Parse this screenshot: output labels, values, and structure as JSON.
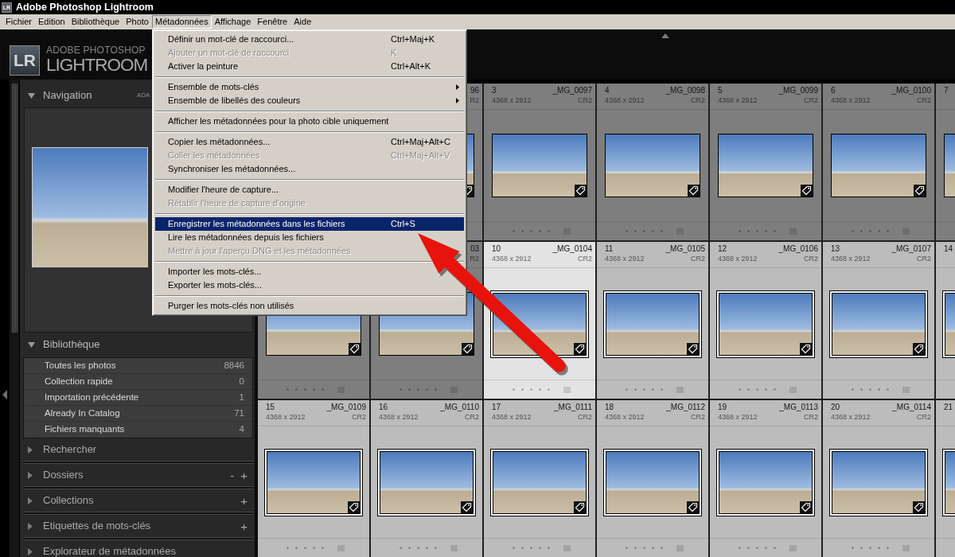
{
  "window": {
    "icon_text": "LR",
    "title": "Adobe Photoshop Lightroom"
  },
  "menu_bar": {
    "items": [
      {
        "label": "Fichier",
        "selected": false
      },
      {
        "label": "Edition",
        "selected": false
      },
      {
        "label": "Bibliothèque",
        "selected": false
      },
      {
        "label": "Photo",
        "selected": false
      },
      {
        "label": "Métadonnées",
        "selected": true
      },
      {
        "label": "Affichage",
        "selected": false
      },
      {
        "label": "Fenêtre",
        "selected": false
      },
      {
        "label": "Aide",
        "selected": false
      }
    ]
  },
  "open_menu": {
    "items": [
      {
        "kind": "item",
        "label": "Définir un mot-clé de raccourci...",
        "shortcut": "Ctrl+Maj+K",
        "disabled": false,
        "selected": false
      },
      {
        "kind": "item",
        "label": "Ajouter un mot-clé de raccourci",
        "shortcut": "K",
        "disabled": true,
        "selected": false
      },
      {
        "kind": "item",
        "label": "Activer la peinture",
        "shortcut": "Ctrl+Alt+K",
        "disabled": false,
        "selected": false
      },
      {
        "kind": "separator"
      },
      {
        "kind": "submenu",
        "label": "Ensemble de mots-clés",
        "disabled": false,
        "selected": false
      },
      {
        "kind": "submenu",
        "label": "Ensemble de libellés des couleurs",
        "disabled": false,
        "selected": false
      },
      {
        "kind": "separator"
      },
      {
        "kind": "item",
        "label": "Afficher les métadonnées pour la photo cible uniquement",
        "disabled": false,
        "selected": false
      },
      {
        "kind": "separator"
      },
      {
        "kind": "item",
        "label": "Copier les métadonnées...",
        "shortcut": "Ctrl+Maj+Alt+C",
        "disabled": false,
        "selected": false
      },
      {
        "kind": "item",
        "label": "Coller les métadonnées",
        "shortcut": "Ctrl+Maj+Alt+V",
        "disabled": true,
        "selected": false
      },
      {
        "kind": "item",
        "label": "Synchroniser les métadonnées...",
        "disabled": false,
        "selected": false
      },
      {
        "kind": "separator"
      },
      {
        "kind": "item",
        "label": "Modifier l'heure de capture...",
        "disabled": false,
        "selected": false
      },
      {
        "kind": "item",
        "label": "Rétablir l'heure de capture d'origine",
        "disabled": true,
        "selected": false
      },
      {
        "kind": "separator"
      },
      {
        "kind": "item",
        "label": "Enregistrer les métadonnées dans les fichiers",
        "shortcut": "Ctrl+S",
        "disabled": false,
        "selected": true
      },
      {
        "kind": "item",
        "label": "Lire les métadonnées depuis les fichiers",
        "disabled": false,
        "selected": false
      },
      {
        "kind": "item",
        "label": "Mettre à jour l'aperçu DNG et les métadonnées",
        "disabled": true,
        "selected": false
      },
      {
        "kind": "separator"
      },
      {
        "kind": "item",
        "label": "Importer les mots-clés...",
        "disabled": false,
        "selected": false
      },
      {
        "kind": "item",
        "label": "Exporter les mots-clés...",
        "disabled": false,
        "selected": false
      },
      {
        "kind": "separator"
      },
      {
        "kind": "item",
        "label": "Purger les mots-clés non utilisés",
        "disabled": false,
        "selected": false
      }
    ]
  },
  "identity_plate": {
    "badge": "LR",
    "subtitle": "ADOBE PHOTOSHOP",
    "name": "LIGHTROOM"
  },
  "left_panel": {
    "sections": [
      {
        "kind": "navigator",
        "title": "Navigation",
        "expanded": true,
        "right_label": "ADA"
      },
      {
        "kind": "list",
        "title": "Bibliothèque",
        "expanded": true,
        "items": [
          {
            "label": "Toutes les photos",
            "count": "8846",
            "selected": false
          },
          {
            "label": "Collection rapide",
            "count": "0",
            "selected": false
          },
          {
            "label": "Importation précédente",
            "count": "1",
            "selected": false
          },
          {
            "label": "Already In Catalog",
            "count": "71",
            "selected": false
          },
          {
            "label": "Fichiers manquants",
            "count": "4",
            "selected": false
          }
        ]
      },
      {
        "kind": "panel",
        "title": "Rechercher",
        "expanded": false
      },
      {
        "kind": "panel",
        "title": "Dossiers",
        "expanded": false,
        "actions": [
          "-",
          "+"
        ]
      },
      {
        "kind": "panel",
        "title": "Collections",
        "expanded": false,
        "actions": [
          "+"
        ]
      },
      {
        "kind": "panel",
        "title": "Etiquettes de mots-clés",
        "expanded": false,
        "actions": [
          "+"
        ]
      },
      {
        "kind": "panel",
        "title": "Explorateur de métadonnées",
        "expanded": false
      }
    ]
  },
  "grid": {
    "rows": [
      {
        "cells": [
          {
            "kind": "covered"
          },
          {
            "kind": "photo",
            "selected": false,
            "current": false,
            "filename": "96",
            "file_type": "R2"
          },
          {
            "kind": "photo",
            "selected": false,
            "current": false,
            "index": "3",
            "filename": "_MG_0097",
            "dimensions": "4368 x 2912",
            "file_type": "CR2",
            "stars": 0
          },
          {
            "kind": "photo",
            "selected": false,
            "current": false,
            "index": "4",
            "filename": "_MG_0098",
            "dimensions": "4368 x 2912",
            "file_type": "CR2",
            "stars": 0
          },
          {
            "kind": "photo",
            "selected": false,
            "current": false,
            "index": "5",
            "filename": "_MG_0099",
            "dimensions": "4368 x 2912",
            "file_type": "CR2",
            "stars": 0
          },
          {
            "kind": "photo",
            "selected": false,
            "current": false,
            "index": "6",
            "filename": "_MG_0100",
            "dimensions": "4368 x 2912",
            "file_type": "CR2",
            "stars": 0
          },
          {
            "kind": "photo",
            "selected": false,
            "current": false,
            "index": "7"
          }
        ]
      },
      {
        "cells": [
          {
            "kind": "photo",
            "selected": false,
            "current": false,
            "stars": 0
          },
          {
            "kind": "photo",
            "selected": false,
            "current": false,
            "filename": "03",
            "file_type": "R2",
            "stars": 0
          },
          {
            "kind": "photo",
            "selected": true,
            "current": true,
            "index": "10",
            "filename": "_MG_0104",
            "dimensions": "4368 x 2912",
            "file_type": "CR2",
            "stars": 0
          },
          {
            "kind": "photo",
            "selected": true,
            "current": false,
            "index": "11",
            "filename": "_MG_0105",
            "dimensions": "4368 x 2912",
            "file_type": "CR2",
            "stars": 0
          },
          {
            "kind": "photo",
            "selected": true,
            "current": false,
            "index": "12",
            "filename": "_MG_0106",
            "dimensions": "4368 x 2912",
            "file_type": "CR2",
            "stars": 0
          },
          {
            "kind": "photo",
            "selected": true,
            "current": false,
            "index": "13",
            "filename": "_MG_0107",
            "dimensions": "4368 x 2912",
            "file_type": "CR2",
            "stars": 0
          },
          {
            "kind": "photo",
            "selected": true,
            "current": false,
            "index": "14"
          }
        ]
      },
      {
        "cells": [
          {
            "kind": "photo",
            "selected": true,
            "current": false,
            "index": "15",
            "filename": "_MG_0109",
            "dimensions": "4368 x 2912",
            "file_type": "CR2",
            "stars": 0
          },
          {
            "kind": "photo",
            "selected": true,
            "current": false,
            "index": "16",
            "filename": "_MG_0110",
            "dimensions": "4368 x 2912",
            "file_type": "CR2",
            "stars": 0
          },
          {
            "kind": "photo",
            "selected": true,
            "current": false,
            "index": "17",
            "filename": "_MG_0111",
            "dimensions": "4368 x 2912",
            "file_type": "CR2",
            "stars": 0
          },
          {
            "kind": "photo",
            "selected": true,
            "current": false,
            "index": "18",
            "filename": "_MG_0112",
            "dimensions": "4368 x 2912",
            "file_type": "CR2",
            "stars": 0
          },
          {
            "kind": "photo",
            "selected": true,
            "current": false,
            "index": "19",
            "filename": "_MG_0113",
            "dimensions": "4368 x 2912",
            "file_type": "CR2",
            "stars": 0
          },
          {
            "kind": "photo",
            "selected": true,
            "current": false,
            "index": "20",
            "filename": "_MG_0114",
            "dimensions": "4368 x 2912",
            "file_type": "CR2",
            "stars": 0
          },
          {
            "kind": "photo",
            "selected": true,
            "current": false,
            "index": "21"
          }
        ]
      }
    ]
  }
}
